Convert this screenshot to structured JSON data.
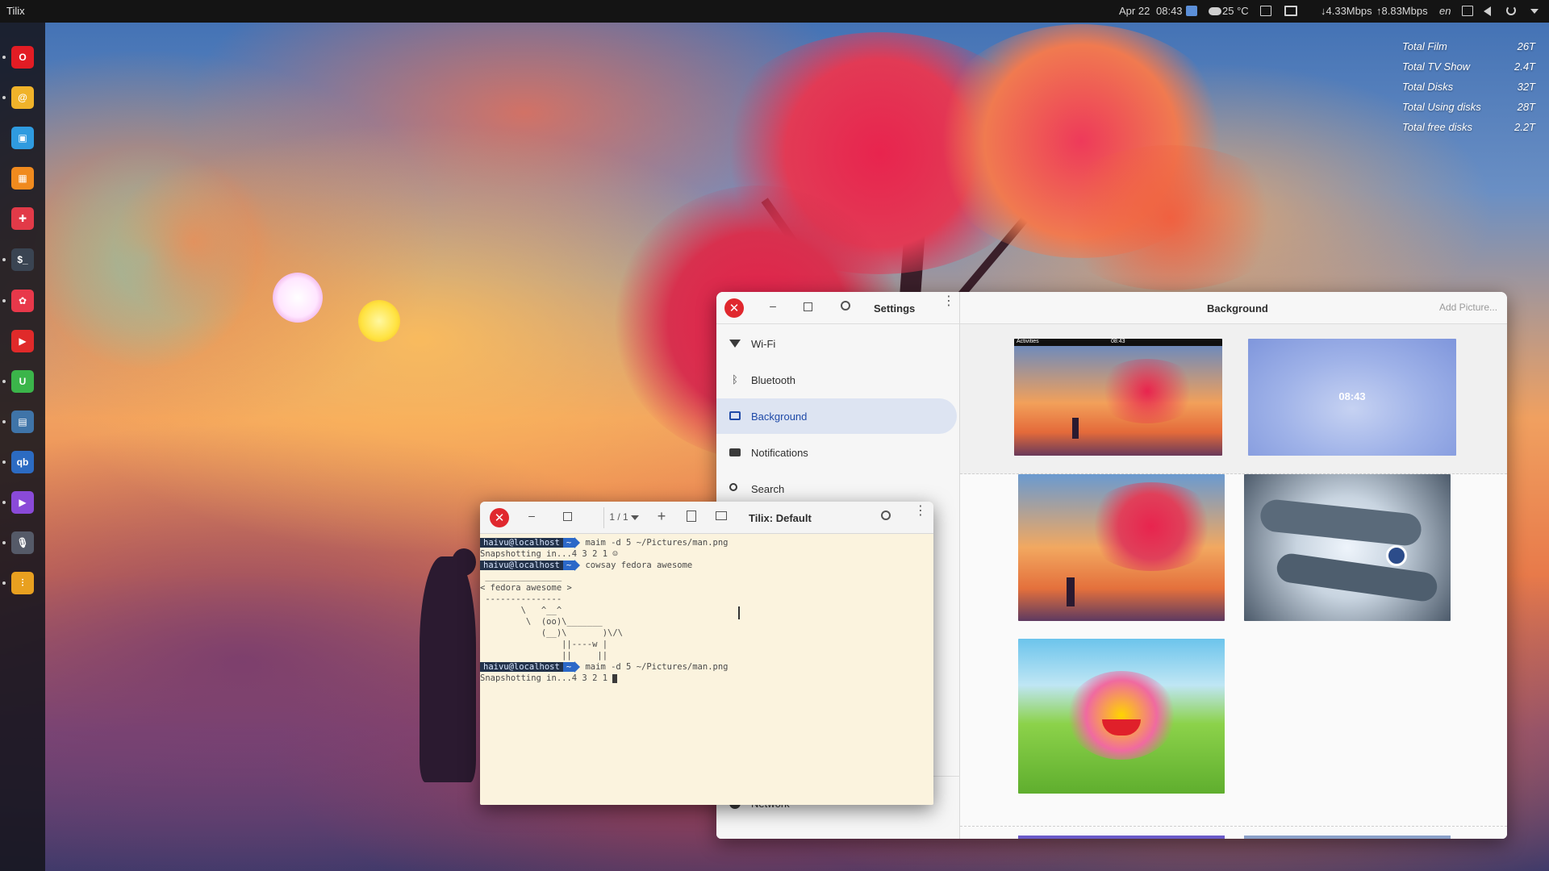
{
  "topbar": {
    "app_name": "Tilix",
    "date": "Apr 22",
    "time": "08:43",
    "weather": "25 °C",
    "net_down": "↓4.33Mbps",
    "net_up": "↑8.83Mbps",
    "lang": "en"
  },
  "dock": {
    "items": [
      {
        "name": "opera",
        "color": "#e21c24",
        "glyph": "O"
      },
      {
        "name": "mail",
        "color": "#f0b32a",
        "glyph": "@"
      },
      {
        "name": "files",
        "color": "#2f9be0",
        "glyph": "▣"
      },
      {
        "name": "archive",
        "color": "#f08a1e",
        "glyph": "▦"
      },
      {
        "name": "puzzle",
        "color": "#e23a48",
        "glyph": "✚"
      },
      {
        "name": "terminal",
        "color": "#3a4452",
        "glyph": "$_"
      },
      {
        "name": "pinwheel",
        "color": "#e8384a",
        "glyph": "✿"
      },
      {
        "name": "youtube",
        "color": "#e02a2a",
        "glyph": "▶"
      },
      {
        "name": "upwork",
        "color": "#3bb54a",
        "glyph": "U"
      },
      {
        "name": "monitor",
        "color": "#3f74a8",
        "glyph": "▤"
      },
      {
        "name": "qbittorrent",
        "color": "#2c6bc2",
        "glyph": "qb"
      },
      {
        "name": "media-player",
        "color": "#8a4ad8",
        "glyph": "▶"
      },
      {
        "name": "podcast",
        "color": "#555a68",
        "glyph": "🎙"
      },
      {
        "name": "equalizer",
        "color": "#e8a020",
        "glyph": "⫶"
      }
    ]
  },
  "conky": {
    "rows": [
      {
        "label": "Total Film",
        "value": "26T"
      },
      {
        "label": "Total TV Show",
        "value": "2.4T"
      },
      {
        "label": "Total Disks",
        "value": "32T"
      },
      {
        "label": "Total Using disks",
        "value": "28T"
      },
      {
        "label": "Total free disks",
        "value": "2.2T"
      }
    ]
  },
  "settings": {
    "title": "Settings",
    "panel_title": "Background",
    "add_picture": "Add Picture...",
    "lock_preview_time": "08:43",
    "desktop_preview_label": "Activities",
    "desktop_preview_time": "08:43",
    "sidebar": [
      {
        "label": "Wi-Fi",
        "icon": "wifi-icon"
      },
      {
        "label": "Bluetooth",
        "icon": "bluetooth-icon"
      },
      {
        "label": "Background",
        "icon": "background-icon",
        "active": true
      },
      {
        "label": "Notifications",
        "icon": "notifications-icon"
      },
      {
        "label": "Search",
        "icon": "search-icon"
      },
      {
        "label": "Network",
        "icon": "network-icon"
      }
    ]
  },
  "tilix": {
    "title": "Tilix: Default",
    "session_counter": "1 / 1",
    "lines": {
      "prompt_user": "haivu@localhost",
      "prompt_dir": "~",
      "cmd1": "maim -d 5 ~/Pictures/man.png",
      "out1": "Snapshotting in...4 3 2 1 ☺",
      "cmd2": "cowsay fedora awesome",
      "cow1": " _______________",
      "cow2": "< fedora awesome >",
      "cow3": " ---------------",
      "cow4": "        \\   ^__^",
      "cow5": "         \\  (oo)\\_______",
      "cow6": "            (__)\\       )\\/\\",
      "cow7": "                ||----w |",
      "cow8": "                ||     ||",
      "cmd3": "maim -d 5 ~/Pictures/man.png",
      "out2": "Snapshotting in...4 3 2 1 "
    }
  }
}
